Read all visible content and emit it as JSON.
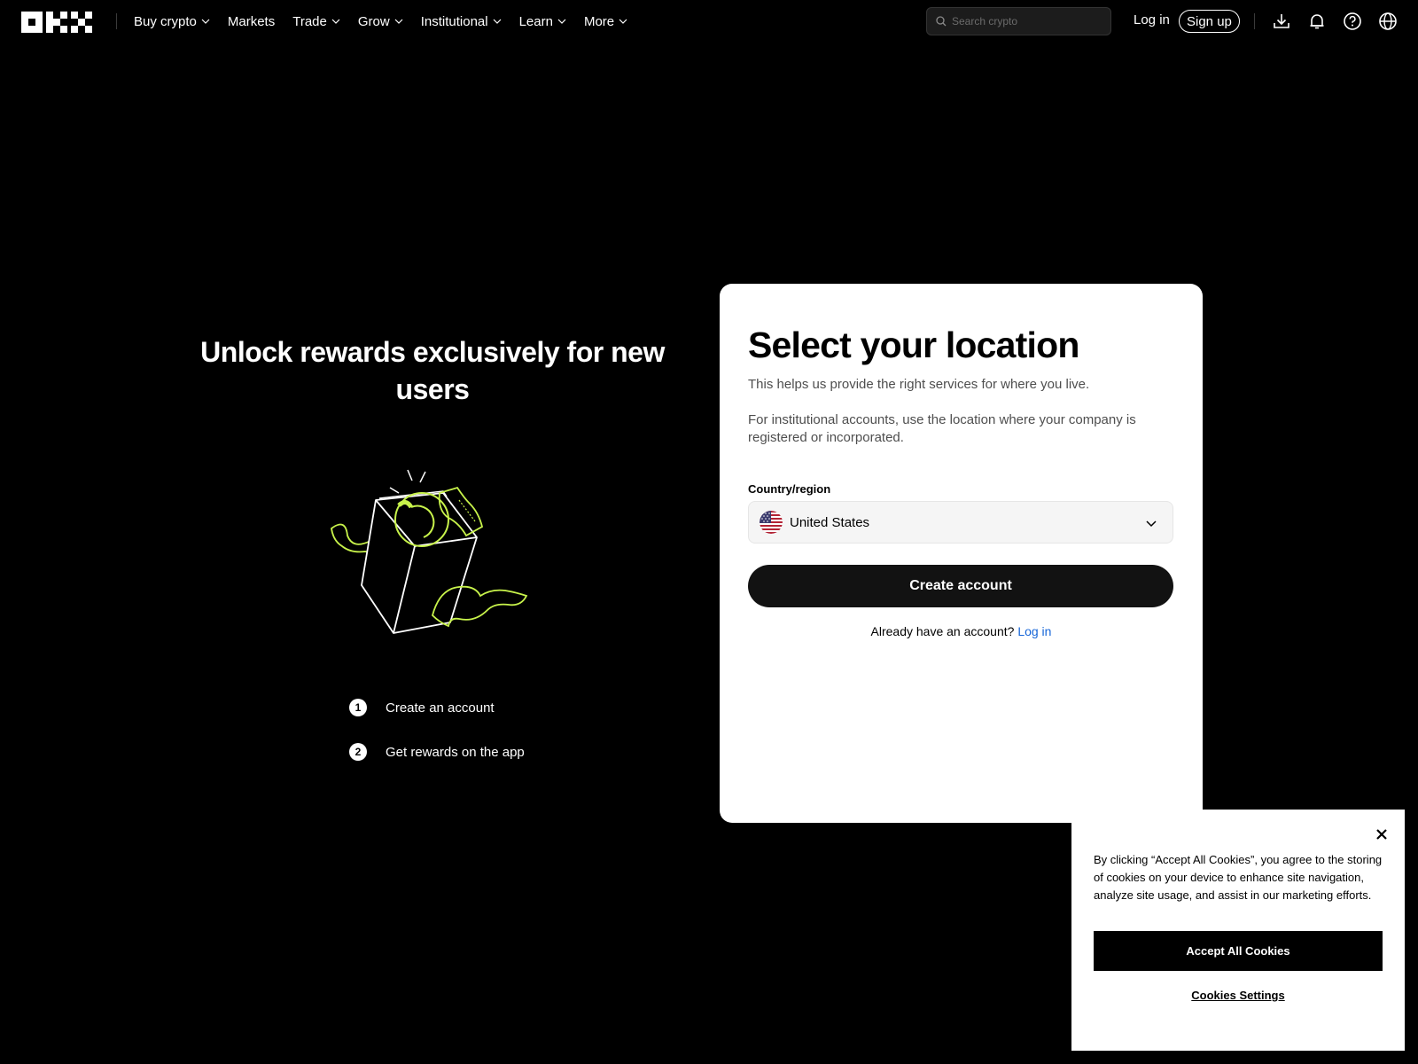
{
  "header": {
    "logo_icon": "okx-logo",
    "nav": [
      {
        "label": "Buy crypto",
        "dropdown": true
      },
      {
        "label": "Markets",
        "dropdown": false
      },
      {
        "label": "Trade",
        "dropdown": true
      },
      {
        "label": "Grow",
        "dropdown": true
      },
      {
        "label": "Institutional",
        "dropdown": true
      },
      {
        "label": "Learn",
        "dropdown": true
      },
      {
        "label": "More",
        "dropdown": true
      }
    ],
    "search_placeholder": "Search crypto",
    "login_label": "Log in",
    "signup_label": "Sign up",
    "icons": [
      "download-icon",
      "bell-icon",
      "help-icon",
      "globe-icon"
    ]
  },
  "promo": {
    "title": "Unlock rewards exclusively for new users",
    "illustration": "gift-box-illustration",
    "accent_color": "#c8f34b",
    "steps": [
      {
        "number": "1",
        "label": "Create an account"
      },
      {
        "number": "2",
        "label": "Get rewards on the app"
      }
    ]
  },
  "card": {
    "title": "Select your location",
    "description_1": "This helps us provide the right services for where you live.",
    "description_2": "For institutional accounts, use the location where your company is registered or incorporated.",
    "field_label": "Country/region",
    "selected_country": "United States",
    "flag_icon": "us-flag-icon",
    "create_button": "Create account",
    "already_text": "Already have an account?",
    "login_link": "Log in",
    "link_color": "#1565d8"
  },
  "cookie": {
    "text": "By clicking “Accept All Cookies”, you agree to the storing of cookies on your device to enhance site navigation, analyze site usage, and assist in our marketing efforts.",
    "accept_label": "Accept All Cookies",
    "settings_label": "Cookies Settings"
  }
}
